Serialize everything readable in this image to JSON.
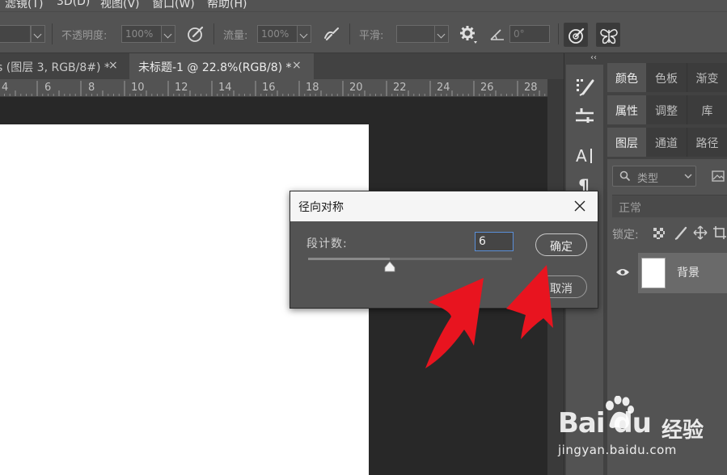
{
  "menubar": {
    "items": [
      "滤镜(T)",
      "3D(D)",
      "视图(V)",
      "窗口(W)",
      "帮助(H)"
    ]
  },
  "options": {
    "opacity_label": "不透明度:",
    "opacity_value": "100%",
    "flow_label": "流量:",
    "flow_value": "100%",
    "smooth_label": "平滑:",
    "angle_value": "0°"
  },
  "tabs": [
    {
      "label": "s (图层 3, RGB/8#) *",
      "close": "×"
    },
    {
      "label": "未标题-1 @ 22.8%(RGB/8) *",
      "close": "×"
    }
  ],
  "ruler": {
    "numbers": [
      "4",
      "6",
      "8",
      "10",
      "12",
      "14",
      "16",
      "18",
      "20",
      "22",
      "24",
      "26",
      "28"
    ]
  },
  "panels": {
    "row1": [
      "颜色",
      "色板",
      "渐变"
    ],
    "row2": [
      "属性",
      "调整",
      "库"
    ],
    "row3": [
      "图层",
      "通道",
      "路径"
    ],
    "filter_label": "类型",
    "blend_mode": "正常",
    "lock_label": "锁定:",
    "layer_name": "背景"
  },
  "dialog": {
    "title": "径向对称",
    "segment_label": "段计数:",
    "segment_value": "6",
    "slider_fraction": 0.4,
    "ok_label": "确定",
    "cancel_label": "取消"
  },
  "watermark": {
    "main": "Bai du",
    "cn": "经验",
    "url": "jingyan.baidu.com"
  },
  "colors": {
    "arrow": "#e8141f",
    "input_focus": "#5a8fd8"
  }
}
